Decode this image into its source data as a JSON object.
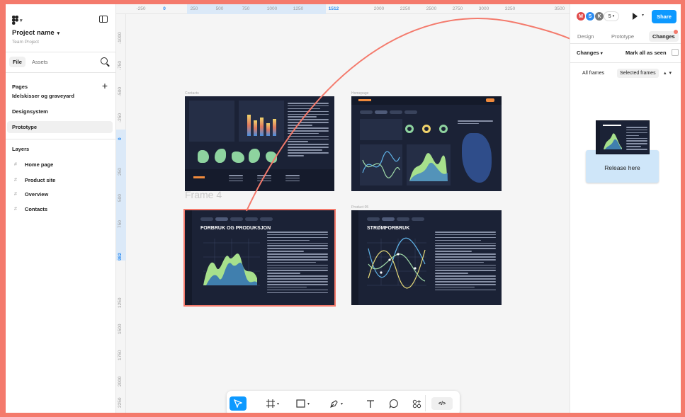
{
  "app": {
    "project_name": "Project name",
    "team": "Team Project",
    "tabs": {
      "file": "File",
      "assets": "Assets"
    }
  },
  "pages": {
    "title": "Pages",
    "items": [
      {
        "label": "Ide/skisser og graveyard"
      },
      {
        "label": "Designsystem"
      },
      {
        "label": "Prototype",
        "active": true
      }
    ]
  },
  "layers": {
    "title": "Layers",
    "items": [
      {
        "label": "Home page"
      },
      {
        "label": "Product site"
      },
      {
        "label": "Overview"
      },
      {
        "label": "Contacts"
      }
    ]
  },
  "rulers": {
    "top": [
      "-250",
      "0",
      "250",
      "500",
      "750",
      "1000",
      "1250",
      "1512",
      "2000",
      "2250",
      "2500",
      "2750",
      "3000",
      "3250",
      "3500"
    ],
    "left": [
      "-1000",
      "-750",
      "-500",
      "-250",
      "0",
      "250",
      "500",
      "750",
      "982",
      "1250",
      "1500",
      "1750",
      "2000",
      "2250",
      "2500"
    ]
  },
  "canvas": {
    "frame_labels": [
      "Contacts",
      "Homepage",
      "Frame 4",
      "Product 05"
    ],
    "frame4_heading": "FORBRUK OG PRODUKSJON",
    "product_heading": "STRØMFORBRUK"
  },
  "right_panel": {
    "avatars": [
      {
        "initial": "M",
        "color": "#e04b4b"
      },
      {
        "initial": "S",
        "color": "#2b8cf2"
      },
      {
        "initial": "K",
        "color": "#7a7a7a"
      }
    ],
    "user_count": "5",
    "share": "Share",
    "tabs": [
      "Design",
      "Prototype",
      "Changes"
    ],
    "changes_dropdown": "Changes",
    "mark_seen": "Mark all as seen",
    "filter_all": "All frames",
    "filter_selected": "Selected frames",
    "release_here": "Release here"
  },
  "toolbar": {
    "tools": [
      "move-tool",
      "frame-tool",
      "shape-tool",
      "pen-tool",
      "text-tool",
      "comment-tool",
      "actions-tool",
      "dev-mode-toggle"
    ],
    "dev_label": "</>"
  },
  "colors": {
    "accent": "#0d99ff",
    "highlight": "#f47a6c",
    "frame_bg": "#1b2236"
  }
}
